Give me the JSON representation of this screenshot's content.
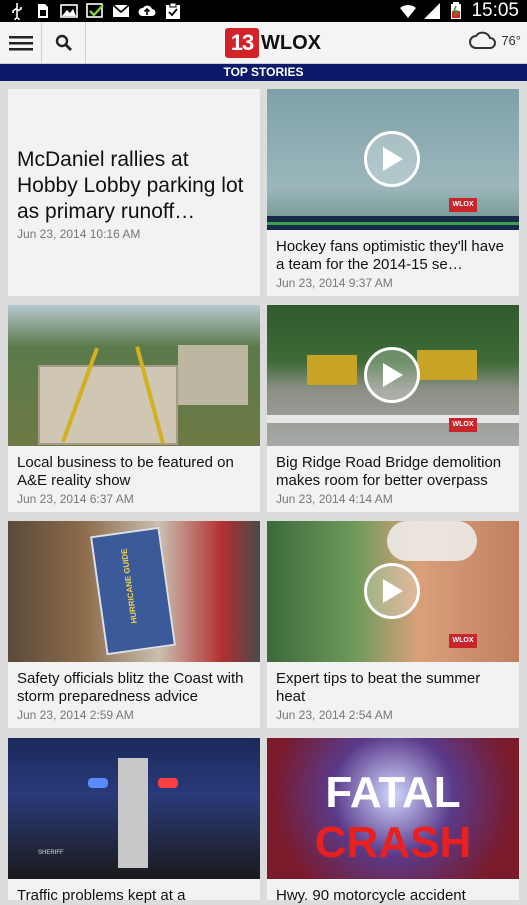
{
  "status_bar": {
    "time": "15:05",
    "icons": [
      "usb-icon",
      "sim-icon",
      "image-icon",
      "check-icon",
      "mail-icon",
      "upload-icon",
      "clipboard-icon",
      "wifi-icon",
      "signal-icon",
      "battery-icon"
    ]
  },
  "app_bar": {
    "logo_number": "13",
    "logo_text": "WLOX",
    "temperature": "76°"
  },
  "section": {
    "title": "TOP STORIES"
  },
  "stories": [
    {
      "title": "McDaniel rallies at Hobby Lobby parking lot as primary runoff…",
      "date": "Jun 23, 2014 10:16 AM"
    },
    {
      "title": "Hockey fans optimistic they'll have a team for the 2014-15 se…",
      "date": "Jun 23, 2014 9:37 AM"
    },
    {
      "title": "Local business to be featured on A&E reality show",
      "date": "Jun 23, 2014 6:37 AM"
    },
    {
      "title": "Big Ridge Road Bridge demolition makes room for better overpass",
      "date": "Jun 23, 2014 4:14 AM"
    },
    {
      "title": "Safety officials blitz the Coast with storm preparedness advice",
      "date": "Jun 23, 2014 2:59 AM"
    },
    {
      "title": "Expert tips to beat the summer heat",
      "date": "Jun 23, 2014 2:54 AM"
    },
    {
      "title": "Traffic problems kept at a",
      "date": ""
    },
    {
      "title": "Hwy. 90 motorcycle accident",
      "date": ""
    }
  ],
  "thumb_text": {
    "guide": "HURRICANE GUIDE",
    "fatal": "FATAL",
    "crash": "CRASH",
    "bug": "WLOX",
    "sheriff": "SHERIFF"
  },
  "colors": {
    "header_bar": "#0b1a6b",
    "brand_red": "#d2232a"
  }
}
